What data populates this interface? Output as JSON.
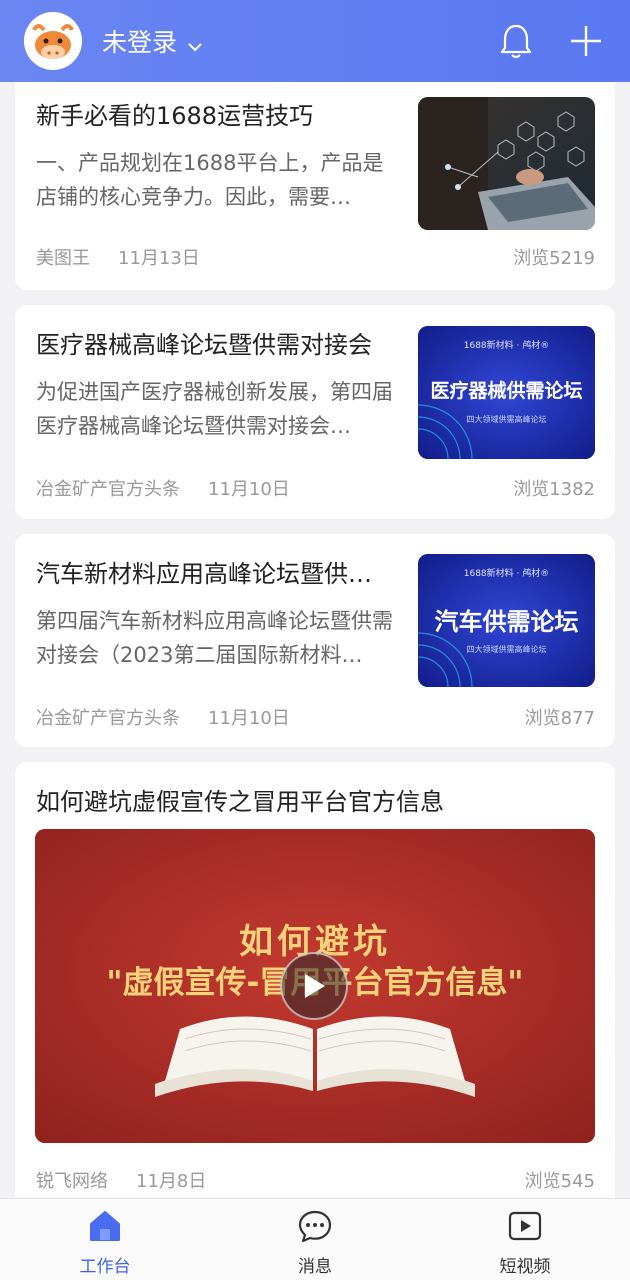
{
  "header": {
    "user_label": "未登录",
    "icons": [
      "avatar-cow",
      "chevron-down-icon",
      "bell-icon",
      "plus-icon"
    ]
  },
  "articles": [
    {
      "title": "新手必看的1688运营技巧",
      "summary": "一、产品规划在1688平台上，产品是店铺的核心竞争力。因此，需要…",
      "author": "美图王",
      "date": "11月13日",
      "views": "浏览5219"
    },
    {
      "title": "医疗器械高峰论坛暨供需对接会",
      "summary": "为促进国产医疗器械创新发展，第四届医疗器械高峰论坛暨供需对接会…",
      "author": "冶金矿产官方头条",
      "date": "11月10日",
      "views": "浏览1382",
      "thumb_text": "医疗器械供需论坛",
      "thumb_sub": "四大领域供需高峰论坛",
      "thumb_top": "1688新材料 · 鸬材®"
    },
    {
      "title": "汽车新材料应用高峰论坛暨供…",
      "summary": "第四届汽车新材料应用高峰论坛暨供需对接会（2023第二届国际新材料…",
      "author": "冶金矿产官方头条",
      "date": "11月10日",
      "views": "浏览877",
      "thumb_text": "汽车供需论坛",
      "thumb_sub": "四大领域供需高峰论坛",
      "thumb_top": "1688新材料 · 鸬材®"
    }
  ],
  "video": {
    "title": "如何避坑虚假宣传之冒用平台官方信息",
    "poster_line1": "如何避坑",
    "poster_line2": "\"虚假宣传-冒用平台官方信息\"",
    "author": "锐飞网络",
    "date": "11月8日",
    "views": "浏览545"
  },
  "tabs": [
    {
      "label": "工作台",
      "icon": "home-icon",
      "active": true
    },
    {
      "label": "消息",
      "icon": "chat-icon",
      "active": false
    },
    {
      "label": "短视频",
      "icon": "play-square-icon",
      "active": false
    }
  ],
  "colors": {
    "header": "#5a78f0",
    "tab_active": "#3d63e6",
    "poster_red": "#b5302a",
    "thumb_blue": "#1e2fb8"
  }
}
